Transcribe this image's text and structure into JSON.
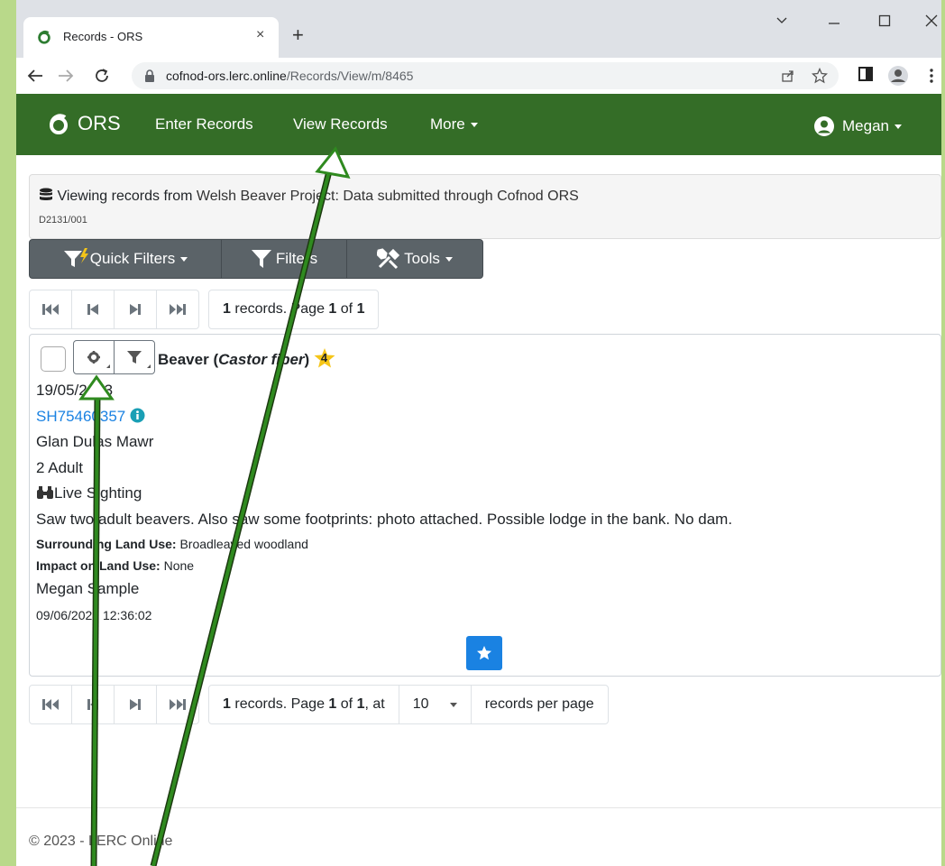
{
  "browser": {
    "tab_title": "Records - ORS",
    "tab_close": "×",
    "new_tab": "+",
    "url_domain": "cofnod-ors.lerc.online",
    "url_path": "/Records/View/m/8465"
  },
  "navbar": {
    "brand": "ORS",
    "enter_records": "Enter Records",
    "view_records": "View Records",
    "more": "More",
    "user": "Megan"
  },
  "info": {
    "prefix": "Viewing records from",
    "project": "Welsh Beaver Project: Data submitted through Cofnod ORS",
    "code": "D2131/001"
  },
  "toolbar": {
    "quick_filters": "Quick Filters",
    "filters": "Filters",
    "tools": "Tools"
  },
  "pager_top": {
    "count": "1",
    "records_text": "records. Page",
    "page": "1",
    "of_text": "of",
    "total": "1"
  },
  "record": {
    "species_common": "Beaver",
    "species_latin": "Castor fiber",
    "badge": "4",
    "date": "19/05/2023",
    "gridref": "SH75460357",
    "site": "Glan Dulas Mawr",
    "abundance": "2 Adult",
    "method": "Live Sighting",
    "comment": "Saw two adult beavers. Also saw some footprints: photo attached. Possible lodge in the bank. No dam.",
    "land_use_label": "Surrounding Land Use:",
    "land_use_value": "Broadleaved woodland",
    "impact_label": "Impact on Land Use:",
    "impact_value": "None",
    "recorder": "Megan Sample",
    "timestamp": "09/06/2023 12:36:02"
  },
  "pager_bottom": {
    "count": "1",
    "records_text": "records. Page",
    "page": "1",
    "of_text": "of",
    "total": "1",
    "at_text": ", at",
    "per_page": "10",
    "per_page_text": "records per page"
  },
  "footer": {
    "text": "© 2023 - LERC Online"
  },
  "colors": {
    "navbar": "#346d27",
    "annotation_arrow": "#2f8a1f",
    "link": "#1a82e2",
    "badge": "#f5c518"
  }
}
